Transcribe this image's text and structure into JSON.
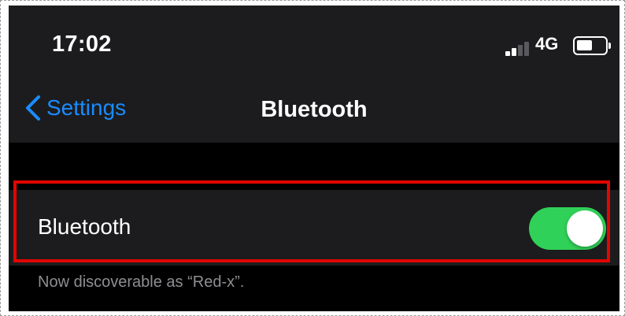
{
  "status_bar": {
    "time": "17:02",
    "network": "4G",
    "signal_bars_active": 2,
    "signal_bars_total": 4,
    "battery_level": 0.55
  },
  "nav": {
    "back_label": "Settings",
    "title": "Bluetooth"
  },
  "settings": {
    "bluetooth_label": "Bluetooth",
    "bluetooth_on": true,
    "discoverable_note": "Now discoverable as “Red-x”."
  },
  "colors": {
    "accent": "#1a8cff",
    "toggle_on": "#30d158",
    "highlight": "#e10600"
  },
  "icons": {
    "back": "chevron-left-icon",
    "signal": "cellular-signal-icon",
    "battery": "battery-icon"
  }
}
